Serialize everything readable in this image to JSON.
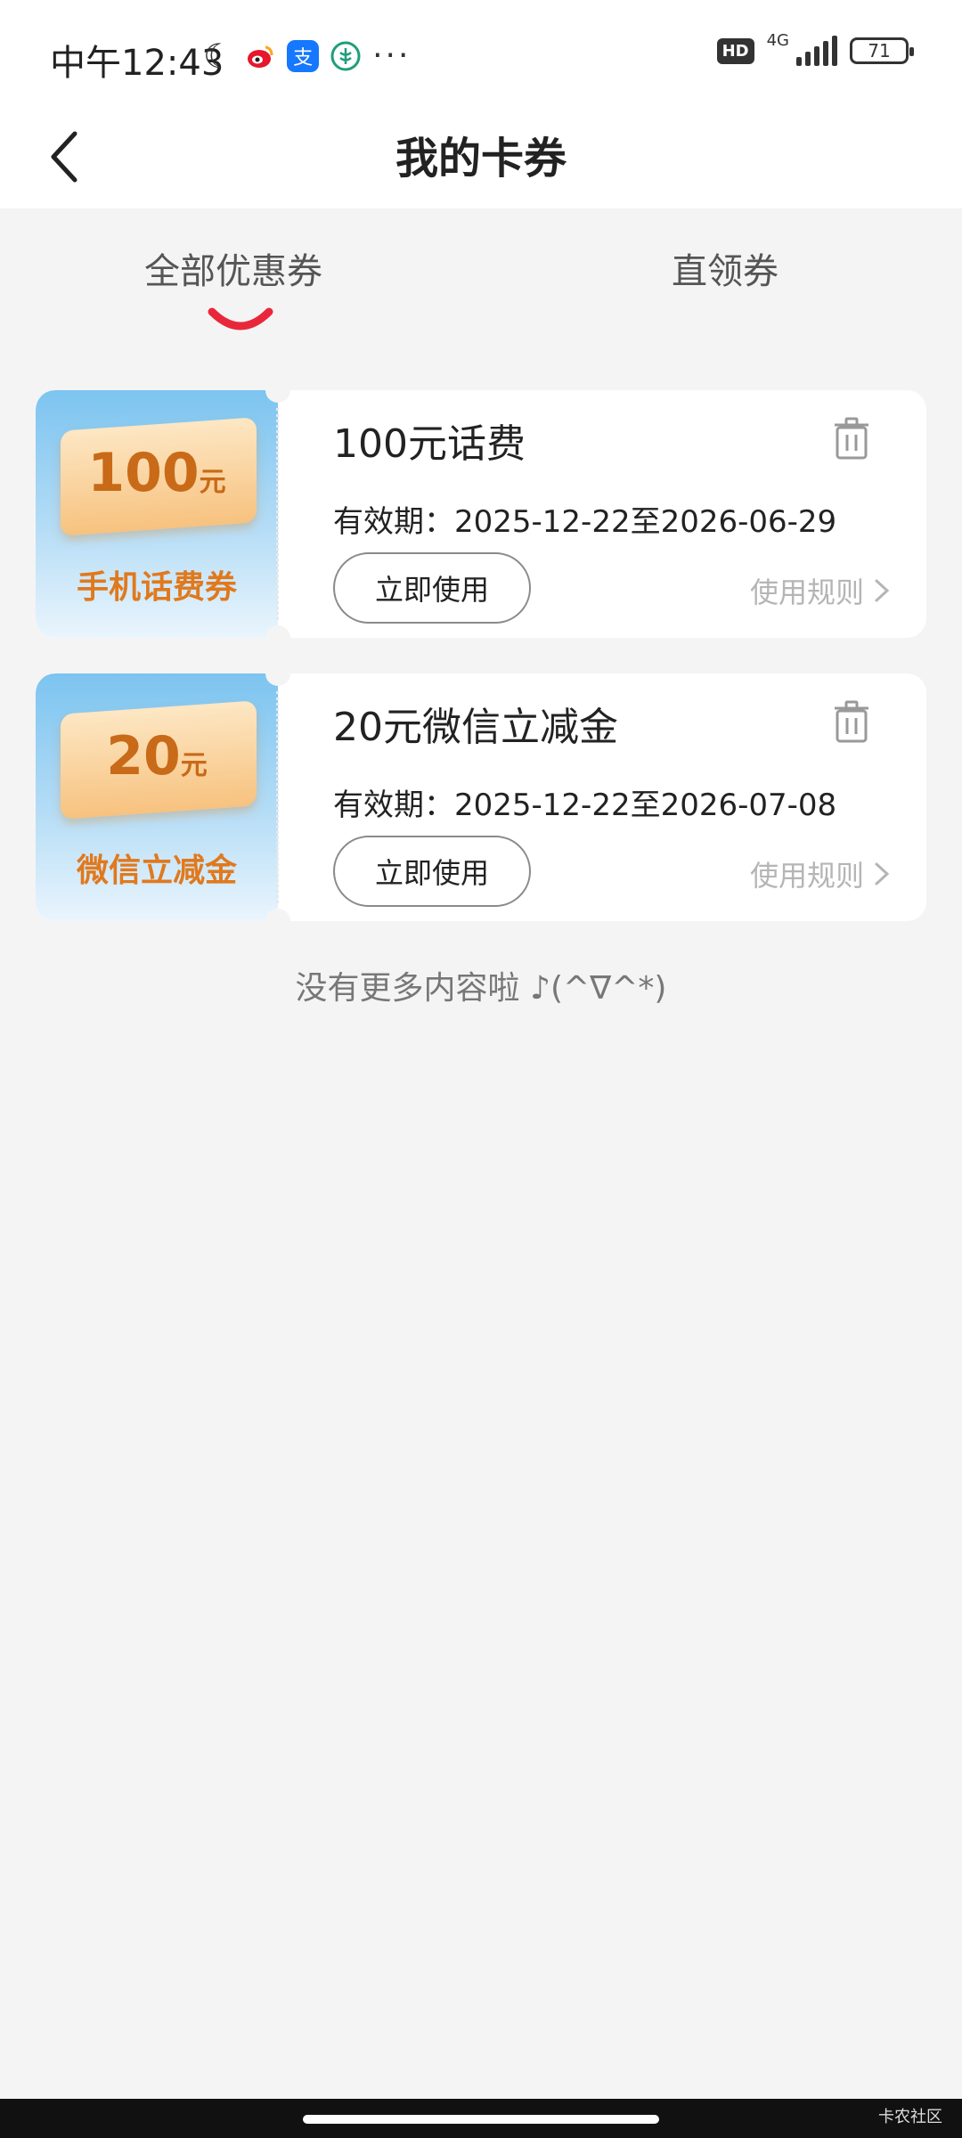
{
  "status_bar": {
    "time": "中午12:43",
    "network": "4G",
    "battery": "71",
    "hd": "HD",
    "more": "···",
    "app_icons": [
      "moon-icon",
      "weibo-icon",
      "alipay-icon",
      "bank-icon"
    ]
  },
  "header": {
    "title": "我的卡券"
  },
  "tabs": [
    {
      "label": "全部优惠券",
      "active": true
    },
    {
      "label": "直领券",
      "active": false
    }
  ],
  "coupons": [
    {
      "thumb_amount": "100",
      "thumb_unit": "元",
      "thumb_caption": "手机话费券",
      "title": "100元话费",
      "validity": "有效期：2025-12-22至2026-06-29",
      "use_label": "立即使用",
      "rules_label": "使用规则"
    },
    {
      "thumb_amount": "20",
      "thumb_unit": "元",
      "thumb_caption": "微信立减金",
      "title": "20元微信立减金",
      "validity": "有效期：2025-12-22至2026-07-08",
      "use_label": "立即使用",
      "rules_label": "使用规则"
    }
  ],
  "footer_note": "没有更多内容啦 ♪(^∇^*)",
  "watermark": "卡农社区",
  "colors": {
    "accent": "#e8283a",
    "thumb_text": "#c86a18",
    "muted": "#b5b5b5"
  }
}
